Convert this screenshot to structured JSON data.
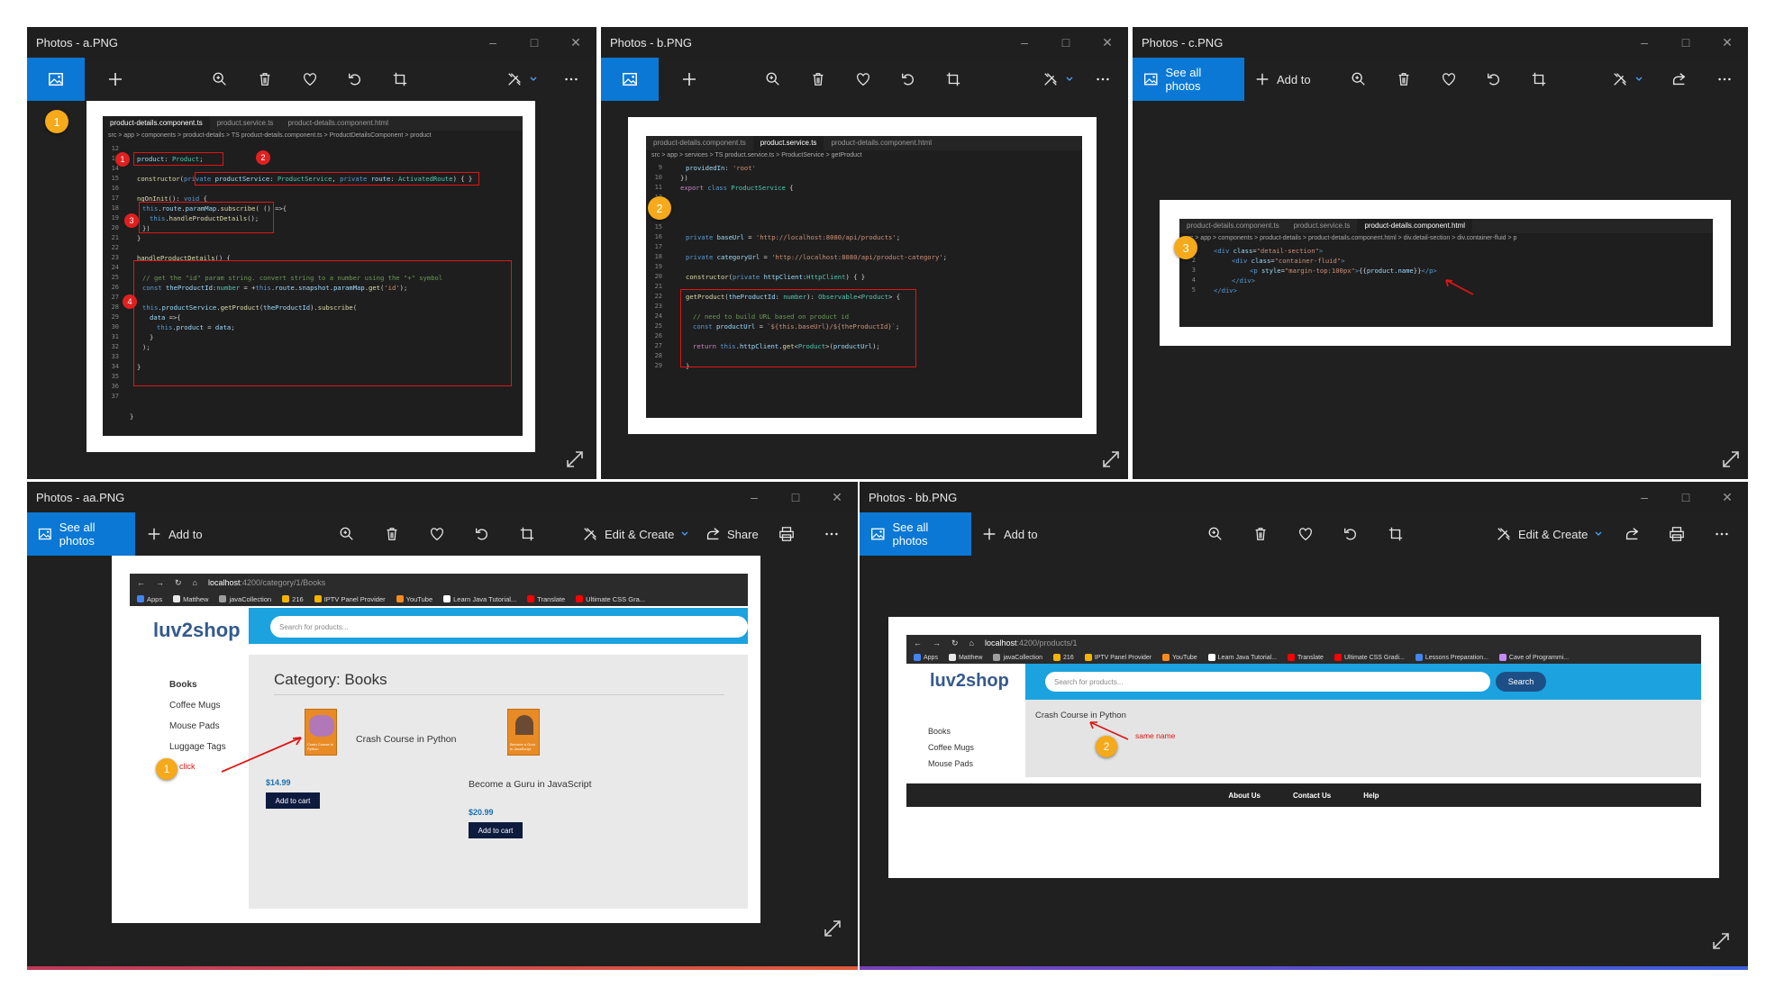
{
  "win_a": {
    "title": "Photos - a.PNG",
    "badge": "1",
    "code": {
      "tabs": [
        "product-details.component.ts",
        "product.service.ts",
        "product-details.component.html"
      ],
      "breadcrumb": "src > app > components > product-details > TS product-details.component.ts > ProductDetailsComponent > product",
      "lines": [
        "12",
        "13",
        "14",
        "15",
        "16",
        "17",
        "18",
        "19",
        "20",
        "21",
        "22",
        "23",
        "24",
        "25",
        "26",
        "27",
        "28",
        "29",
        "30",
        "31",
        "32",
        "33",
        "34",
        "35",
        "36",
        "37"
      ],
      "markers": [
        "1",
        "2",
        "3",
        "4"
      ]
    }
  },
  "win_b": {
    "title": "Photos - b.PNG",
    "badge": "2",
    "code": {
      "tabs": [
        "product-details.component.ts",
        "product.service.ts",
        "product-details.component.html"
      ],
      "breadcrumb": "src > app > services > TS product.service.ts > ProductService > getProduct",
      "lines": [
        "9",
        "10",
        "11",
        "12",
        "13",
        "14",
        "15",
        "16",
        "17",
        "18",
        "19",
        "20",
        "21",
        "22",
        "23",
        "24",
        "25",
        "26",
        "27",
        "28",
        "29"
      ]
    }
  },
  "win_c": {
    "title": "Photos - c.PNG",
    "see_all": "See all photos",
    "add_to": "Add to",
    "badge": "3",
    "code": {
      "tabs": [
        "product-details.component.ts",
        "product.service.ts",
        "product-details.component.html"
      ],
      "breadcrumb": "src > app > components > product-details > product-details.component.html > div.detail-section > div.container-fluid > p",
      "lines": [
        "1",
        "2",
        "3",
        "4",
        "5"
      ]
    }
  },
  "win_aa": {
    "title": "Photos - aa.PNG",
    "see_all": "See all photos",
    "add_to": "Add to",
    "edit_create": "Edit & Create",
    "share": "Share",
    "browser": {
      "url_host": "localhost",
      "url_path": ":4200/category/1/Books",
      "bookmarks": [
        "Apps",
        "Matthew",
        "javaCollection",
        "216",
        "IPTV Panel Provider",
        "YouTube",
        "Learn Java Tutorial...",
        "Translate",
        "Ultimate CSS Gra..."
      ],
      "logo": "luv2shop",
      "search_placeholder": "Search for products...",
      "categories": [
        "Books",
        "Coffee Mugs",
        "Mouse Pads",
        "Luggage Tags"
      ],
      "heading": "Category: Books",
      "products": [
        {
          "name": "Crash Course in Python",
          "price": "$14.99",
          "button": "Add to cart",
          "cover": "Crash Course in Python"
        },
        {
          "name": "Become a Guru in JavaScript",
          "price": "$20.99",
          "button": "Add to cart",
          "cover": "Become a Guru in JavaScript"
        }
      ],
      "annotation": "click",
      "badge": "1"
    }
  },
  "win_bb": {
    "title": "Photos - bb.PNG",
    "see_all": "See all photos",
    "add_to": "Add to",
    "edit_create": "Edit & Create",
    "browser": {
      "url_host": "localhost",
      "url_path": ":4200/products/1",
      "bookmarks": [
        "Apps",
        "Matthew",
        "javaCollection",
        "216",
        "IPTV Panel Provider",
        "YouTube",
        "Learn Java Tutorial...",
        "Translate",
        "Ultimate CSS Gradi...",
        "Lessons Preparation...",
        "Cave of Programmi..."
      ],
      "logo": "luv2shop",
      "search_placeholder": "Search for products...",
      "search_button": "Search",
      "categories": [
        "Books",
        "Coffee Mugs",
        "Mouse Pads"
      ],
      "product_name": "Crash Course in Python",
      "annotation": "same name",
      "badge": "2",
      "footer": [
        "About Us",
        "Contact Us",
        "Help"
      ]
    }
  },
  "colors": {
    "app_bg": "#202020",
    "accent": "#0a78d4",
    "badge": "#f5a91b",
    "annotation_red": "#e01515",
    "shop_blue": "#1ba2df",
    "shop_navy": "#0d1b3e"
  }
}
